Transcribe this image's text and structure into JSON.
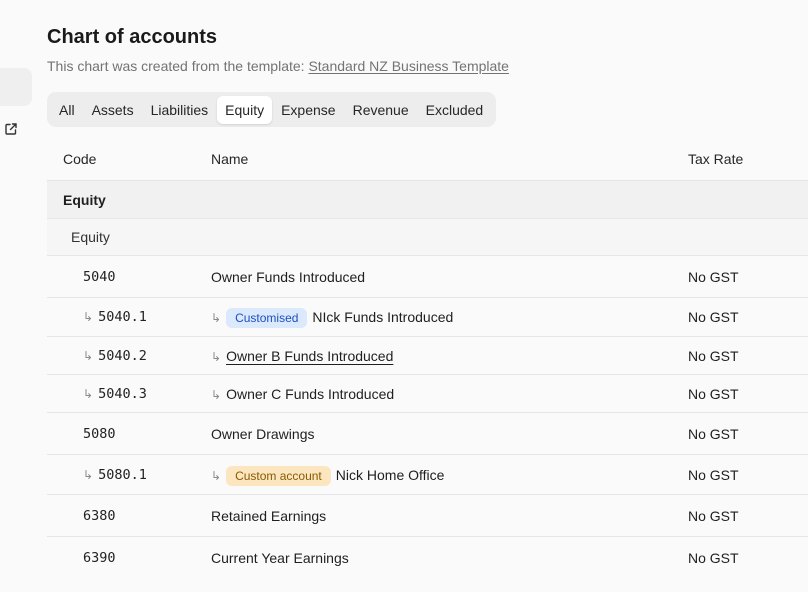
{
  "page": {
    "title": "Chart of accounts",
    "subtitle_prefix": "This chart was created from the template: ",
    "template_link": "Standard NZ Business Template"
  },
  "tabs": [
    "All",
    "Assets",
    "Liabilities",
    "Equity",
    "Expense",
    "Revenue",
    "Excluded"
  ],
  "active_tab": "Equity",
  "columns": {
    "code": "Code",
    "name": "Name",
    "tax": "Tax Rate"
  },
  "group": {
    "label": "Equity",
    "sub_label": "Equity"
  },
  "rows": [
    {
      "code": "5040",
      "name": "Owner Funds Introduced",
      "tax": "No GST",
      "child": false
    },
    {
      "code": "5040.1",
      "name": "NIck Funds Introduced",
      "tax": "No GST",
      "child": true,
      "badge": "Customised"
    },
    {
      "code": "5040.2",
      "name": "Owner B Funds Introduced",
      "tax": "No GST",
      "child": true
    },
    {
      "code": "5040.3",
      "name": "Owner C Funds Introduced",
      "tax": "No GST",
      "child": true
    },
    {
      "code": "5080",
      "name": "Owner Drawings",
      "tax": "No GST",
      "child": false
    },
    {
      "code": "5080.1",
      "name": "Nick Home Office",
      "tax": "No GST",
      "child": true,
      "badge": "Custom account"
    },
    {
      "code": "6380",
      "name": "Retained Earnings",
      "tax": "No GST",
      "child": false
    },
    {
      "code": "6390",
      "name": "Current Year Earnings",
      "tax": "No GST",
      "child": false
    }
  ],
  "arrow_glyph": "↳",
  "colors": {
    "badge_customised": "#dbe9fd",
    "badge_custom_account": "#fbe6c0"
  },
  "icons": {
    "sidebar": "external-link-icon"
  }
}
